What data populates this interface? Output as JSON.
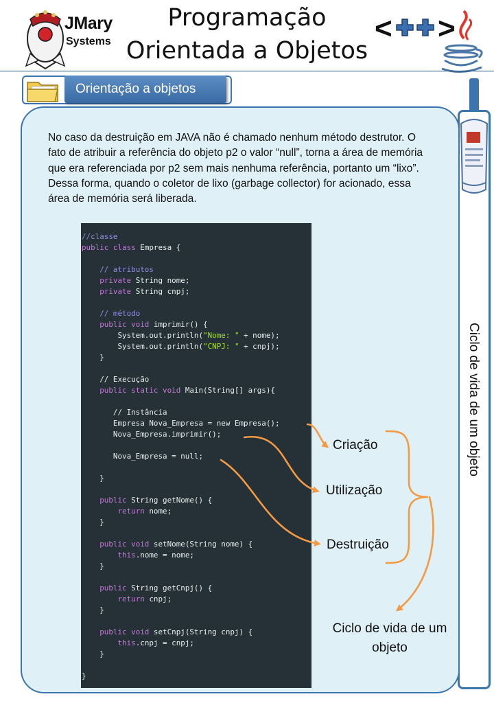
{
  "header": {
    "logo": {
      "line1": "JMary",
      "line2": "Systems"
    },
    "title_line1": "Programação",
    "title_line2": "Orientada a Objetos",
    "cpp_logo_text": "<++>"
  },
  "section": {
    "tab_label": "Orientação a objetos"
  },
  "sidebar": {
    "label": "Ciclo de vida de um objeto"
  },
  "content": {
    "paragraph": "No caso da destruição em JAVA não é chamado nenhum método destrutor. O fato de atribuir a referência do objeto p2 o valor “null”, torna a área de memória que era referenciada por p2 sem mais nenhuma referência, portanto um “lixo”. Dessa forma, quando o coletor de lixo (garbage collector) for acionado, essa área de memória será liberada."
  },
  "code_lines": [
    [
      [
        "cm",
        "//classe"
      ]
    ],
    [
      [
        "kw",
        "public class"
      ],
      [
        "",
        " Empresa {"
      ]
    ],
    [],
    [
      [
        "",
        "    "
      ],
      [
        "cm",
        "// atributos"
      ]
    ],
    [
      [
        "",
        "    "
      ],
      [
        "kw",
        "private"
      ],
      [
        "",
        " String nome;"
      ]
    ],
    [
      [
        "",
        "    "
      ],
      [
        "kw",
        "private"
      ],
      [
        "",
        " String cnpj;"
      ]
    ],
    [],
    [
      [
        "",
        "    "
      ],
      [
        "cm",
        "// método"
      ]
    ],
    [
      [
        "",
        "    "
      ],
      [
        "kw",
        "public void"
      ],
      [
        "",
        " imprimir() {"
      ]
    ],
    [
      [
        "",
        "        System.out.println("
      ],
      [
        "st",
        "\"Nome: \""
      ],
      [
        "",
        " + nome);"
      ]
    ],
    [
      [
        "",
        "        System.out.println("
      ],
      [
        "st",
        "\"CNPJ: \""
      ],
      [
        "",
        " + cnpj);"
      ]
    ],
    [
      [
        "",
        "    }"
      ]
    ],
    [],
    [
      [
        "",
        "    // Execução"
      ]
    ],
    [
      [
        "",
        "    "
      ],
      [
        "kw",
        "public static void"
      ],
      [
        "",
        " Main(String[] args){"
      ]
    ],
    [],
    [
      [
        "",
        "       // Instância"
      ]
    ],
    [
      [
        "",
        "       Empresa Nova_Empresa = new Empresa();"
      ]
    ],
    [
      [
        "",
        "       Nova_Empresa.imprimir();"
      ]
    ],
    [],
    [
      [
        "",
        "       Nova_Empresa = null;"
      ]
    ],
    [],
    [
      [
        "",
        "    }"
      ]
    ],
    [],
    [
      [
        "",
        "    "
      ],
      [
        "kw",
        "public"
      ],
      [
        "",
        " String getNome() {"
      ]
    ],
    [
      [
        "",
        "        "
      ],
      [
        "kw",
        "return"
      ],
      [
        "",
        " nome;"
      ]
    ],
    [
      [
        "",
        "    }"
      ]
    ],
    [],
    [
      [
        "",
        "    "
      ],
      [
        "kw",
        "public void"
      ],
      [
        "",
        " setNome(String nome) {"
      ]
    ],
    [
      [
        "",
        "        "
      ],
      [
        "kw",
        "this"
      ],
      [
        "",
        ".nome = nome;"
      ]
    ],
    [
      [
        "",
        "    }"
      ]
    ],
    [],
    [
      [
        "",
        "    "
      ],
      [
        "kw",
        "public"
      ],
      [
        "",
        " String getCnpj() {"
      ]
    ],
    [
      [
        "",
        "        "
      ],
      [
        "kw",
        "return"
      ],
      [
        "",
        " cnpj;"
      ]
    ],
    [
      [
        "",
        "    }"
      ]
    ],
    [],
    [
      [
        "",
        "    "
      ],
      [
        "kw",
        "public void"
      ],
      [
        "",
        " setCnpj(String cnpj) {"
      ]
    ],
    [
      [
        "",
        "        "
      ],
      [
        "kw",
        "this"
      ],
      [
        "",
        ".cnpj = cnpj;"
      ]
    ],
    [
      [
        "",
        "    }"
      ]
    ],
    [],
    [
      [
        "",
        "}"
      ]
    ]
  ],
  "annotations": {
    "creation": "Criação",
    "usage": "Utilização",
    "destruction": "Destruição",
    "lifecycle": "Ciclo de vida de um objeto"
  },
  "colors": {
    "accent_blue": "#3b75ad",
    "panel_bg": "#dff0f6",
    "code_bg": "#263137",
    "arrow_orange": "#f39a43",
    "code_comment": "#8e8fe0",
    "code_keyword": "#c478d8",
    "code_string": "#a6e22e"
  },
  "icons": {
    "logo": "duke-mascot-icon",
    "cpp": "cpp-logo-icon",
    "java": "java-cup-icon",
    "folder": "folder-icon",
    "sidebar": "newspaper-icon"
  }
}
